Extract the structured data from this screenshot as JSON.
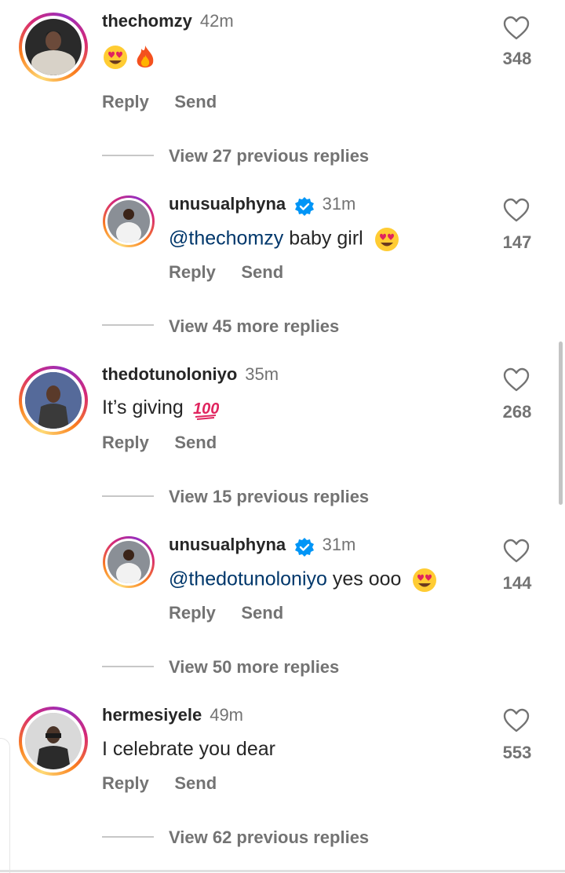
{
  "comments": [
    {
      "username": "thechomzy",
      "time": "42m",
      "text": "",
      "emojis": [
        "heart-eyes-emoji",
        "fire-emoji"
      ],
      "likes": "348",
      "reply": "Reply",
      "send": "Send",
      "view_replies": "View 27 previous replies",
      "reply_item": {
        "username": "unusualphyna",
        "time": "31m",
        "mention": "@thechomzy",
        "text": " baby girl",
        "likes": "147",
        "reply": "Reply",
        "send": "Send",
        "more_replies": "View 45 more replies"
      }
    },
    {
      "username": "thedotunoloniyo",
      "time": "35m",
      "text": "It’s giving",
      "emojis": [
        "hundred-emoji"
      ],
      "likes": "268",
      "reply": "Reply",
      "send": "Send",
      "view_replies": "View 15 previous replies",
      "reply_item": {
        "username": "unusualphyna",
        "time": "31m",
        "mention": "@thedotunoloniyo",
        "text": " yes ooo",
        "likes": "144",
        "reply": "Reply",
        "send": "Send",
        "more_replies": "View 50 more replies"
      }
    },
    {
      "username": "hermesiyele",
      "time": "49m",
      "text": "I celebrate you dear",
      "emojis": [],
      "likes": "553",
      "reply": "Reply",
      "send": "Send",
      "view_replies": "View 62 previous replies"
    }
  ],
  "colors": {
    "verified": "#0095f6",
    "mention": "#00376b",
    "secondary": "#737373"
  },
  "icons": [
    "heart-outline-icon",
    "verified-badge-icon"
  ]
}
